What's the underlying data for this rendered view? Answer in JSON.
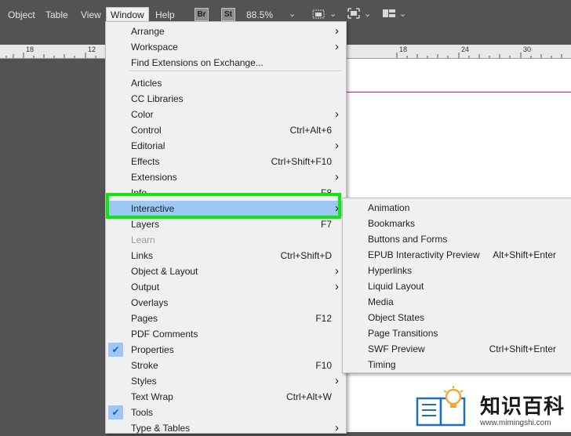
{
  "menubar": {
    "items": [
      "Object",
      "Table",
      "View",
      "Window",
      "Help"
    ],
    "bridge_badge": "Br",
    "stock_badge": "St",
    "zoom": "88.5%"
  },
  "ruler": {
    "labels": [
      "18",
      "12",
      "18",
      "24",
      "30"
    ]
  },
  "window_menu": {
    "items": [
      {
        "label": "Arrange",
        "shortcut": "",
        "submenu": true
      },
      {
        "label": "Workspace",
        "shortcut": "",
        "submenu": true
      },
      {
        "label": "Find Extensions on Exchange...",
        "shortcut": "",
        "submenu": false
      },
      {
        "label": "Articles",
        "shortcut": "",
        "submenu": false
      },
      {
        "label": "CC Libraries",
        "shortcut": "",
        "submenu": false
      },
      {
        "label": "Color",
        "shortcut": "",
        "submenu": true
      },
      {
        "label": "Control",
        "shortcut": "Ctrl+Alt+6",
        "submenu": false
      },
      {
        "label": "Editorial",
        "shortcut": "",
        "submenu": true
      },
      {
        "label": "Effects",
        "shortcut": "Ctrl+Shift+F10",
        "submenu": false
      },
      {
        "label": "Extensions",
        "shortcut": "",
        "submenu": true
      },
      {
        "label": "Info",
        "shortcut": "F8",
        "submenu": false
      },
      {
        "label": "Interactive",
        "shortcut": "",
        "submenu": true
      },
      {
        "label": "Layers",
        "shortcut": "F7",
        "submenu": false
      },
      {
        "label": "Learn",
        "shortcut": "",
        "submenu": false
      },
      {
        "label": "Links",
        "shortcut": "Ctrl+Shift+D",
        "submenu": false
      },
      {
        "label": "Object & Layout",
        "shortcut": "",
        "submenu": true
      },
      {
        "label": "Output",
        "shortcut": "",
        "submenu": true
      },
      {
        "label": "Overlays",
        "shortcut": "",
        "submenu": false
      },
      {
        "label": "Pages",
        "shortcut": "F12",
        "submenu": false
      },
      {
        "label": "PDF Comments",
        "shortcut": "",
        "submenu": false
      },
      {
        "label": "Properties",
        "shortcut": "",
        "submenu": false
      },
      {
        "label": "Stroke",
        "shortcut": "F10",
        "submenu": false
      },
      {
        "label": "Styles",
        "shortcut": "",
        "submenu": true
      },
      {
        "label": "Text Wrap",
        "shortcut": "Ctrl+Alt+W",
        "submenu": false
      },
      {
        "label": "Tools",
        "shortcut": "",
        "submenu": false
      },
      {
        "label": "Type & Tables",
        "shortcut": "",
        "submenu": true
      }
    ],
    "checked": [
      "Properties",
      "Tools"
    ],
    "highlighted": "Interactive",
    "disabled": [
      "Learn"
    ]
  },
  "interactive_submenu": {
    "items": [
      {
        "label": "Animation",
        "shortcut": ""
      },
      {
        "label": "Bookmarks",
        "shortcut": ""
      },
      {
        "label": "Buttons and Forms",
        "shortcut": ""
      },
      {
        "label": "EPUB Interactivity Preview",
        "shortcut": "Alt+Shift+Enter"
      },
      {
        "label": "Hyperlinks",
        "shortcut": ""
      },
      {
        "label": "Liquid Layout",
        "shortcut": ""
      },
      {
        "label": "Media",
        "shortcut": ""
      },
      {
        "label": "Object States",
        "shortcut": ""
      },
      {
        "label": "Page Transitions",
        "shortcut": ""
      },
      {
        "label": "SWF Preview",
        "shortcut": "Ctrl+Shift+Enter"
      },
      {
        "label": "Timing",
        "shortcut": ""
      }
    ]
  },
  "watermark": {
    "title": "知识百科",
    "url": "www.mimingshi.com"
  },
  "colors": {
    "highlight": "#9bc8f5",
    "callout": "#0ee60e",
    "guide": "#e000e0"
  }
}
